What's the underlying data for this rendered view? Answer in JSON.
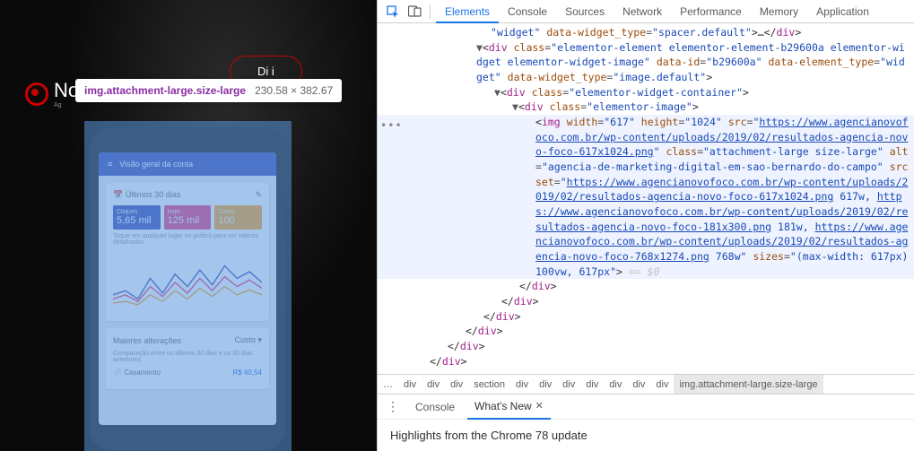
{
  "page": {
    "logo_text": "No",
    "logo_sub": "Ag",
    "button": "Di      i"
  },
  "tooltip": {
    "selector": "img.attachment-large.size-large",
    "dimensions": "230.58 × 382.67"
  },
  "phone": {
    "header": "Visão geral da conta",
    "card_title": "Últimos 30 dias",
    "metrics": [
      {
        "label": "Cliques",
        "value": "5,65 mil"
      },
      {
        "label": "Impr.",
        "value": "125 mil"
      },
      {
        "label": "Custo",
        "value": "100"
      }
    ],
    "chart_hint": "Toque em qualquer lugar no gráfico para ver valores detalhados",
    "section2_title": "Maiores alterações",
    "section2_right": "Custo ▾",
    "section2_sub": "Comparação entre os últimos 30 dias e os 30 dias anteriores",
    "row_label": "Casamento",
    "row_val": "R$ 60,54"
  },
  "devtools": {
    "tabs": [
      "Elements",
      "Console",
      "Sources",
      "Network",
      "Performance",
      "Memory",
      "Application"
    ],
    "active_tab": 0,
    "code": {
      "l1a": "\"widget\"",
      "l1b": "data-widget_type",
      "l1c": "\"spacer.default\"",
      "l2a": "div",
      "l2b": "class",
      "l2c": "\"elementor-element elementor-element-b29600a elementor-widget elementor-widget-image\"",
      "l2d": "data-id",
      "l2e": "\"b29600a\"",
      "l2f": "data-element_type",
      "l2g": "\"widget\"",
      "l2h": "data-widget_type",
      "l2i": "\"image.default\"",
      "l3a": "div",
      "l3b": "class",
      "l3c": "\"elementor-widget-container\"",
      "l4a": "div",
      "l4b": "class",
      "l4c": "\"elementor-image\"",
      "l5a": "img",
      "l5b": "width",
      "l5c": "\"617\"",
      "l5d": "height",
      "l5e": "\"1024\"",
      "l5f": "src",
      "url1": "https://www.agencianovofoco.com.br/wp-content/uploads/2019/02/resultados-agencia-novo-foco-617x1024.png",
      "l5g": "class",
      "l5h": "\"attachment-large size-large\"",
      "l5i": "alt",
      "l5j": "\"agencia-de-marketing-digital-em-sao-bernardo-do-campo\"",
      "l5k": "srcset",
      "url2": "https://www.agencianovofoco.com.br/wp-content/uploads/2019/02/resultados-agencia-novo-foco-617x1024.png",
      "sz2": " 617w, ",
      "url3": "https://www.agencianovofoco.com.br/wp-content/uploads/2019/02/resultados-agencia-novo-foco-181x300.png",
      "sz3": " 181w, ",
      "url4": "https://www.agencianovofoco.com.br/wp-content/uploads/2019/02/resultados-agencia-novo-foco-768x1274.png",
      "sz4": " 768w\"",
      "l5l": "sizes",
      "l5m": "\"(max-width: 617px) 100vw, 617px\"",
      "eos": " == $0",
      "close_div": "div"
    },
    "breadcrumb": [
      "…",
      "div",
      "div",
      "div",
      "section",
      "div",
      "div",
      "div",
      "div",
      "div",
      "div",
      "div",
      "img.attachment-large.size-large"
    ],
    "breadcrumb_sel": 12,
    "drawer_tabs": [
      "Console",
      "What's New"
    ],
    "drawer_active": 1,
    "drawer_headline": "Highlights from the Chrome 78 update"
  }
}
